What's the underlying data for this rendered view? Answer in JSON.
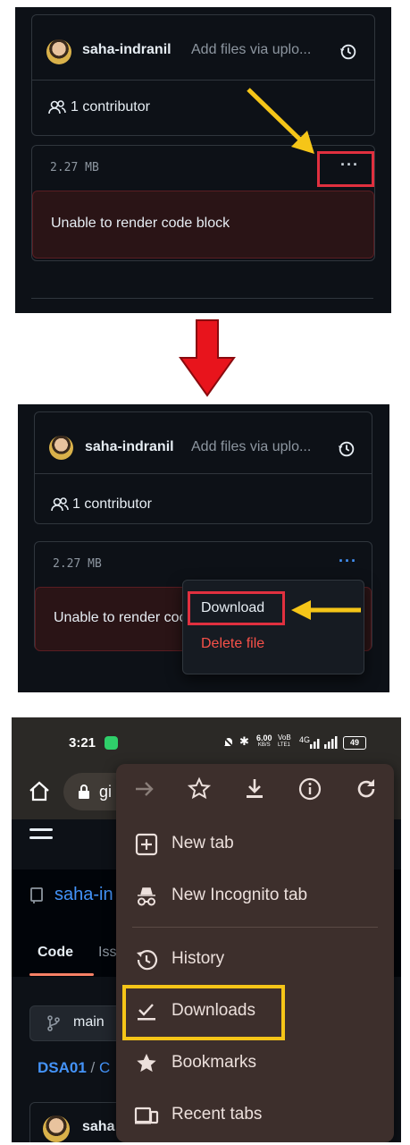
{
  "panel1": {
    "username": "saha-indranil",
    "commit_message": "Add files via uplo...",
    "contributors": "1 contributor",
    "file_size": "2.27 MB",
    "more_label": "···",
    "error": "Unable to render code block"
  },
  "panel2": {
    "username": "saha-indranil",
    "commit_message": "Add files via uplo...",
    "contributors": "1 contributor",
    "file_size": "2.27 MB",
    "more_label": "···",
    "error": "Unable to render coc",
    "menu": {
      "download": "Download",
      "delete": "Delete file"
    }
  },
  "phone": {
    "status": {
      "time": "3:21",
      "speed": "6.00",
      "speed_unit": "KB/S",
      "net1": "VoB",
      "net1b": "LTE1",
      "net2": "4G",
      "battery": "49"
    },
    "chrome": {
      "url": "gi"
    },
    "page": {
      "repo": "saha-in",
      "tab_code": "Code",
      "tab_issues": "Iss",
      "branch": "main",
      "breadcrumb_repo": "DSA01",
      "breadcrumb_sep": "/",
      "breadcrumb_next": "C",
      "user": "saha"
    },
    "menu": {
      "items": [
        {
          "label": "New tab",
          "icon": "new-tab-icon"
        },
        {
          "label": "New Incognito tab",
          "icon": "incognito-icon"
        },
        {
          "label": "History",
          "icon": "history-icon"
        },
        {
          "label": "Downloads",
          "icon": "downloads-check-icon"
        },
        {
          "label": "Bookmarks",
          "icon": "star-icon"
        },
        {
          "label": "Recent tabs",
          "icon": "devices-icon"
        }
      ]
    }
  },
  "colors": {
    "annotation_red": "#e0303f",
    "annotation_yellow": "#f5c518",
    "github_dark": "#0d1117",
    "chrome_menu": "#3d2f2c"
  }
}
